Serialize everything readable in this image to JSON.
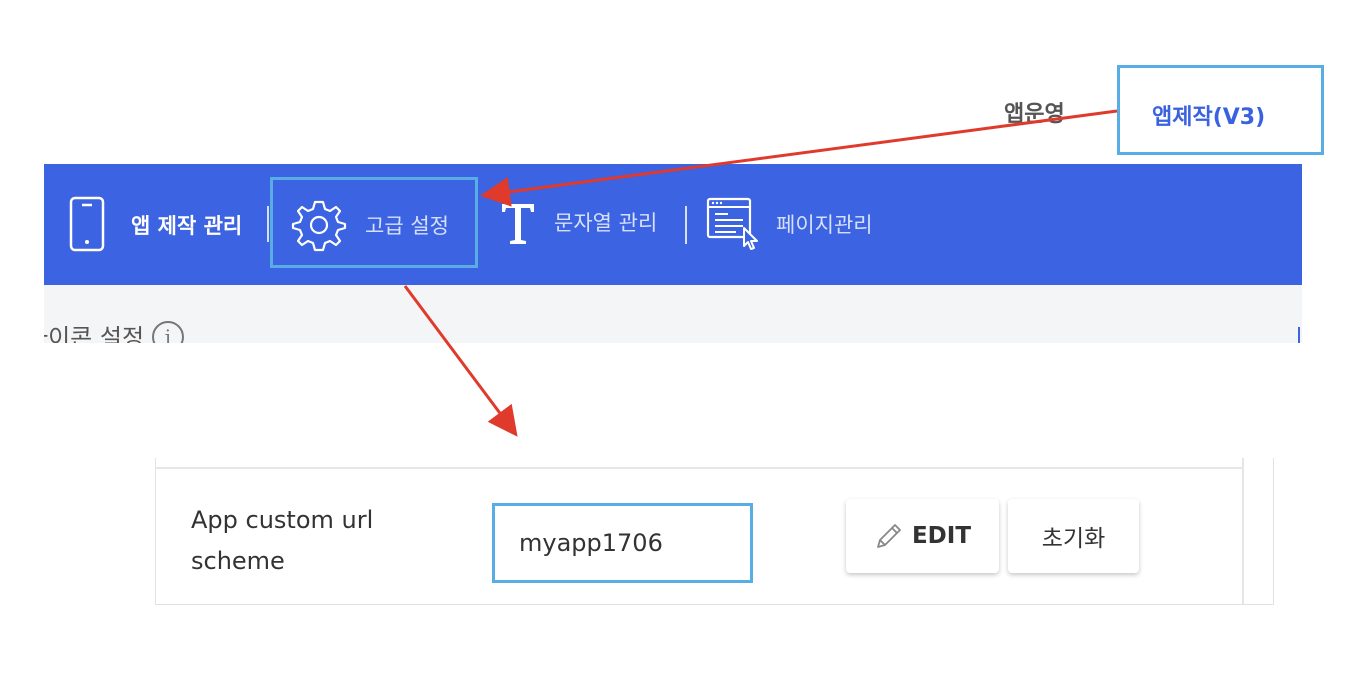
{
  "top_tabs": {
    "operate": "앱운영",
    "make": "앱제작(V3)"
  },
  "nav": {
    "app_manage": "앱 제작 관리",
    "advanced": "고급 설정",
    "strings": "문자열 관리",
    "pages": "페이지관리"
  },
  "section": {
    "title": "아이콘 설정"
  },
  "form": {
    "label": "App custom url scheme",
    "value": "myapp1706",
    "edit_label": "EDIT",
    "reset_label": "초기화"
  },
  "icons": [
    "phone-icon",
    "gear-icon",
    "text-t-icon",
    "page-list-icon",
    "info-icon",
    "pencil-icon"
  ],
  "colors": {
    "nav_bg": "#3b63e2",
    "highlight": "#57ade4",
    "arrow": "#e03a2c",
    "active_tab": "#3a62e0"
  }
}
